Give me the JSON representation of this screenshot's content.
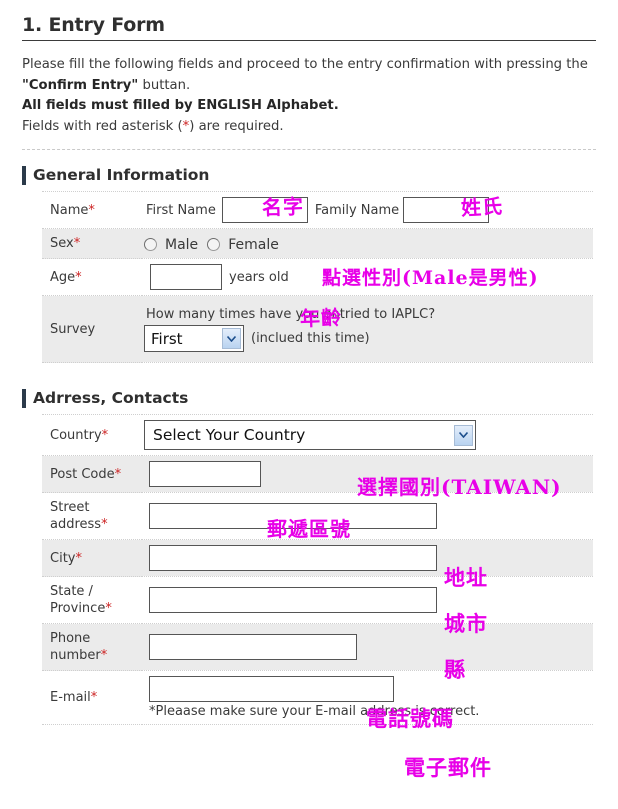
{
  "page": {
    "title": "1. Entry Form"
  },
  "intro": {
    "line1_a": "Please fill the following fields and proceed to the entry confirmation with pressing the ",
    "line1_b": "\"Confirm Entry\"",
    "line1_c": " buttan.",
    "line2": "All fields must filled by ENGLISH Alphabet.",
    "line3_a": "Fields with red asterisk (",
    "line3_ast": "*",
    "line3_b": ") are required."
  },
  "sections": [
    {
      "title": "General Information"
    },
    {
      "title": "Adrress, Contacts"
    }
  ],
  "general": {
    "name": {
      "label": "Name",
      "first_label": "First Name",
      "first_value": "",
      "family_label": "Family Name",
      "family_value": ""
    },
    "sex": {
      "label": "Sex",
      "male": "Male",
      "female": "Female"
    },
    "age": {
      "label": "Age",
      "value": "",
      "unit": "years old"
    },
    "survey": {
      "label": "Survey",
      "question": "How many times have you entried to IAPLC?",
      "selected": "First",
      "suffix": "(inclued this time)"
    }
  },
  "address": {
    "country": {
      "label": "Country",
      "selected": "Select Your Country"
    },
    "post_code": {
      "label": "Post Code",
      "value": ""
    },
    "street": {
      "label": "Street address",
      "value": ""
    },
    "city": {
      "label": "City",
      "value": ""
    },
    "state": {
      "label": "State / Province",
      "value": ""
    },
    "phone": {
      "label": "Phone number",
      "value": ""
    },
    "email": {
      "label": "E-mail",
      "value": "",
      "note": "*Pleaase make sure your E-mail address is correct."
    }
  },
  "annotations": {
    "color": "#e800e8",
    "first_name": "名字",
    "family_name": "姓氏",
    "sex": "點選性別(Male是男性)",
    "age": "年齡",
    "country": "選擇國別(TAIWAN)",
    "post_code": "郵遞區號",
    "street": "地址",
    "city": "城市",
    "state": "縣",
    "phone": "電話號碼",
    "email": "電子郵件"
  },
  "asterisk": "*"
}
